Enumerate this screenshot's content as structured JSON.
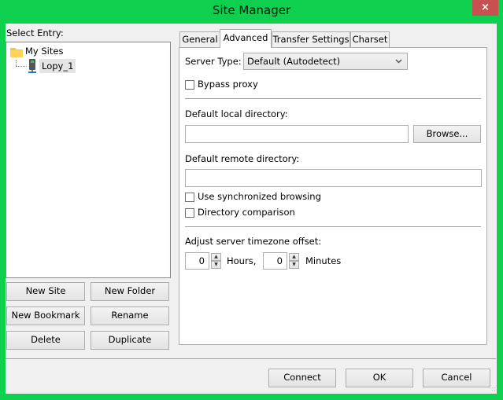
{
  "window": {
    "title": "Site Manager",
    "close_icon": "×",
    "accent_color": "#0fcf4e",
    "close_color": "#c75050"
  },
  "left": {
    "select_entry_label": "Select Entry:",
    "tree": [
      {
        "label": "My Sites",
        "icon": "folder-icon",
        "expanded": true
      },
      {
        "label": "Lopy_1",
        "icon": "server-icon",
        "selected": true
      }
    ],
    "buttons": {
      "new_site": "New Site",
      "new_folder": "New Folder",
      "new_bookmark": "New Bookmark",
      "rename": "Rename",
      "delete": "Delete",
      "duplicate": "Duplicate"
    }
  },
  "tabs": [
    {
      "label": "General",
      "active": false
    },
    {
      "label": "Advanced",
      "active": true
    },
    {
      "label": "Transfer Settings",
      "active": false
    },
    {
      "label": "Charset",
      "active": false
    }
  ],
  "advanced": {
    "server_type_label": "Server Type:",
    "server_type_value": "Default (Autodetect)",
    "bypass_proxy_label": "Bypass proxy",
    "bypass_proxy_checked": false,
    "local_dir_label": "Default local directory:",
    "local_dir_value": "",
    "browse_label": "Browse...",
    "remote_dir_label": "Default remote directory:",
    "remote_dir_value": "",
    "sync_browsing_label": "Use synchronized browsing",
    "sync_browsing_checked": false,
    "dir_comparison_label": "Directory comparison",
    "dir_comparison_checked": false,
    "timezone_label": "Adjust server timezone offset:",
    "hours_value": "0",
    "hours_label": "Hours,",
    "minutes_value": "0",
    "minutes_label": "Minutes"
  },
  "footer": {
    "connect": "Connect",
    "ok": "OK",
    "cancel": "Cancel"
  }
}
